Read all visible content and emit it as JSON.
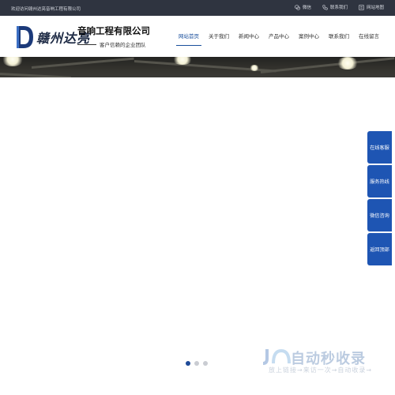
{
  "topbar": {
    "welcome": "欢迎访问赣州达亮音响工程有限公司",
    "links": [
      {
        "label": "微信",
        "icon": "wechat-icon"
      },
      {
        "label": "联系我们",
        "icon": "phone-icon"
      },
      {
        "label": "网站地图",
        "icon": "sitemap-icon"
      }
    ]
  },
  "logo": {
    "letter": "D",
    "cursive": "赣州达亮"
  },
  "brand": {
    "company": "音响工程有限公司",
    "slogan": "客户信赖的企业团队"
  },
  "nav": [
    {
      "label": "网站首页",
      "active": true
    },
    {
      "label": "关于我们",
      "active": false
    },
    {
      "label": "新闻中心",
      "active": false
    },
    {
      "label": "产品中心",
      "active": false
    },
    {
      "label": "案例中心",
      "active": false
    },
    {
      "label": "联系我们",
      "active": false
    },
    {
      "label": "在线留言",
      "active": false
    }
  ],
  "side_buttons": [
    "在线客服",
    "服务热线",
    "微信咨询",
    "返回顶部"
  ],
  "carousel": {
    "count": 3,
    "active": 0
  },
  "watermark": {
    "title": "自动秒收录",
    "subtitle": "放上链接→来访一次→自动收录→"
  },
  "colors": {
    "accent": "#1e55b3",
    "topbar_bg": "#2f3440",
    "nav_active": "#1a4f9c"
  }
}
